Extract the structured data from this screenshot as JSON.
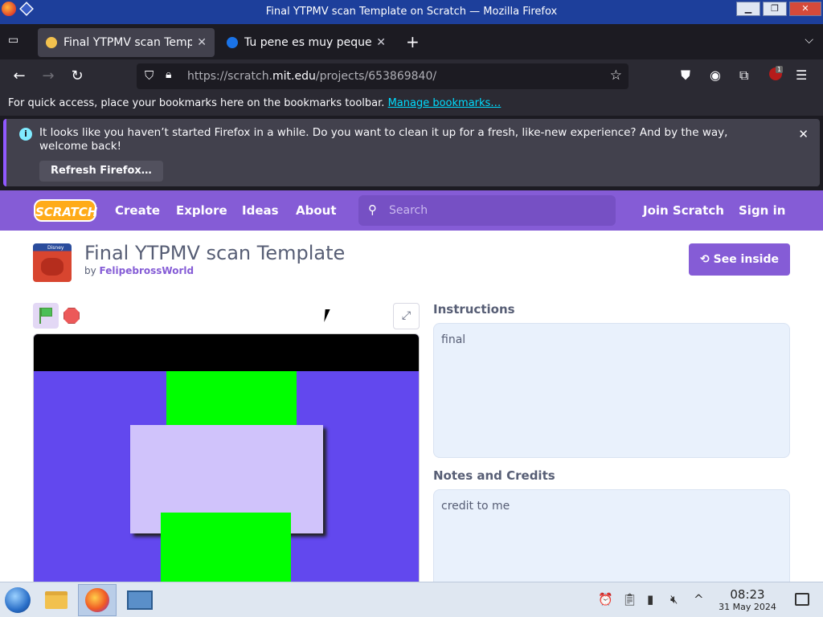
{
  "window": {
    "title": "Final YTPMV scan Template on Scratch — Mozilla Firefox",
    "controls": [
      "▁",
      "❐",
      "✕"
    ]
  },
  "tabs": [
    {
      "label": "Final YTPMV scan Template on Scratch",
      "close": "✕",
      "favicon_color": "#f2c14e"
    },
    {
      "label": "Tu pene es muy pequeño",
      "close": "✕",
      "favicon_color": "#1a73e8"
    }
  ],
  "toolbar": {
    "new_tab": "+",
    "tabs_overflow": "⌵",
    "back": "←",
    "forward": "→",
    "reload": "↻",
    "url_prefix": "https://scratch.",
    "url_domain": "mit.edu",
    "url_path": "/projects/653869840/",
    "bookmark_star": "☆",
    "extension_badge": "1"
  },
  "bookmarks_bar": {
    "text": "For quick access, place your bookmarks here on the bookmarks toolbar.",
    "link": "Manage bookmarks…"
  },
  "notification": {
    "message": "It looks like you haven’t started Firefox in a while. Do you want to clean it up for a fresh, like-new experience? And by the way, welcome back!",
    "button": "Refresh Firefox…",
    "close": "✕"
  },
  "scratch": {
    "logo": "SCRATCH",
    "nav": {
      "create": "Create",
      "explore": "Explore",
      "ideas": "Ideas",
      "about": "About",
      "join": "Join Scratch",
      "signin": "Sign in"
    },
    "search_placeholder": "Search",
    "project": {
      "title": "Final YTPMV scan Template",
      "by": "by",
      "author": "FelipebrossWorld",
      "see_inside": "See inside",
      "thumb_tag": "Disney"
    },
    "instructions": {
      "heading": "Instructions",
      "text": "final"
    },
    "notes": {
      "heading": "Notes and Credits",
      "text": "credit to me"
    }
  },
  "taskbar": {
    "time": "08:23",
    "date": "31 May 2024"
  },
  "colors": {
    "scratch_purple": "#855cd6",
    "stage_bg": "#6248ee",
    "green": "#00ff00"
  }
}
